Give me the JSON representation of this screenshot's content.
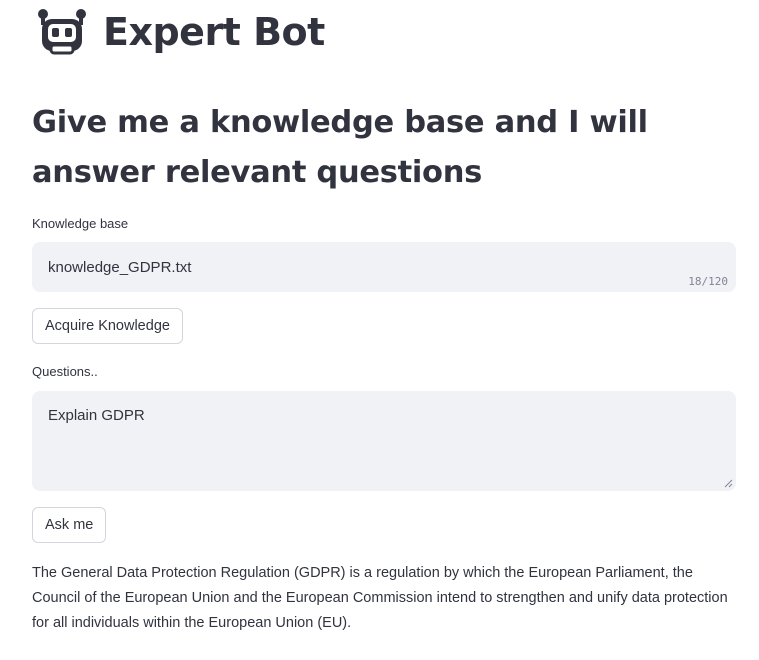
{
  "app": {
    "title": "Expert Bot",
    "logo_icon": "robot-face-icon"
  },
  "subheader": "Give me a knowledge base and I will answer relevant questions",
  "knowledge_base": {
    "label": "Knowledge base",
    "value": "knowledge_GDPR.txt",
    "char_count": "18/120"
  },
  "acquire_button_label": "Acquire Knowledge",
  "questions": {
    "label": "Questions..",
    "value": "Explain GDPR"
  },
  "ask_button_label": "Ask me",
  "answer": "The General Data Protection Regulation (GDPR) is a regulation by which the European Parliament, the Council of the European Union and the European Commission intend to strengthen and unify data protection for all individuals within the European Union (EU).",
  "colors": {
    "text": "#31333f",
    "input_bg": "#f0f2f6",
    "button_border": "#d3d6dc"
  }
}
